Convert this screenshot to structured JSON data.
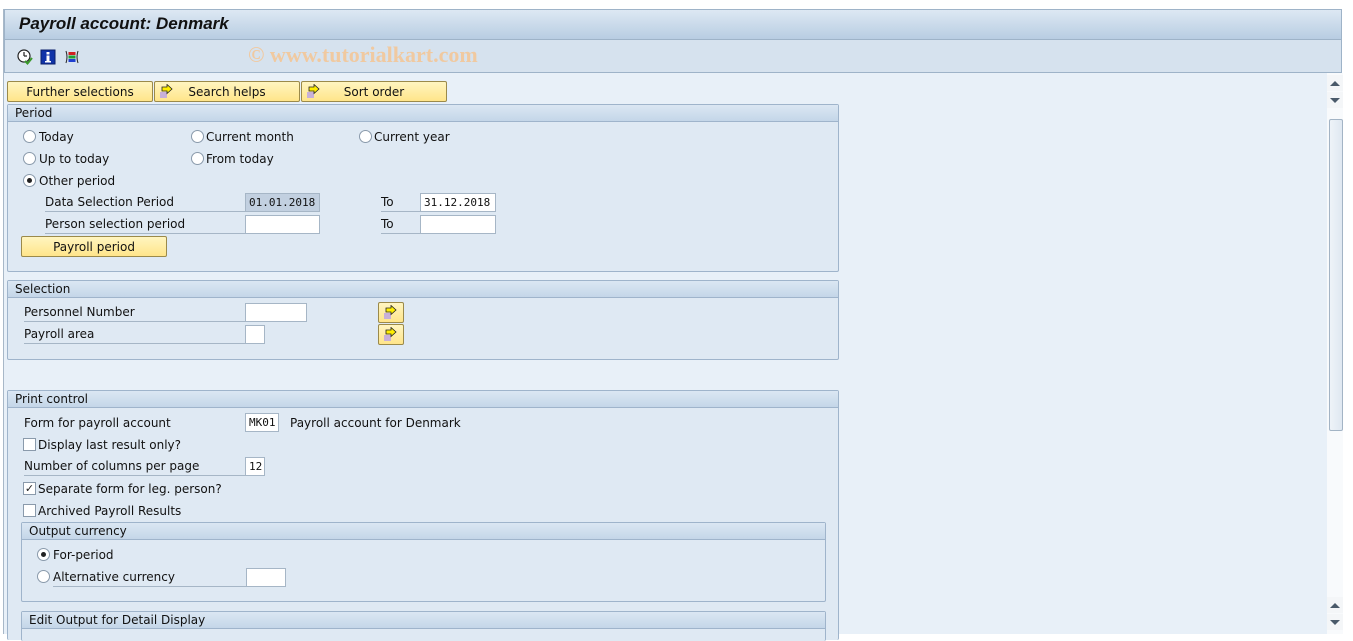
{
  "window": {
    "title": "Payroll account: Denmark",
    "watermark": "© www.tutorialkart.com"
  },
  "toolbar": {
    "icons": [
      "execute-clock-icon",
      "info-icon",
      "selection-variant-icon"
    ]
  },
  "buttons": {
    "further_selections": "Further selections",
    "search_helps": "Search helps",
    "sort_order": "Sort order"
  },
  "period": {
    "title": "Period",
    "options": {
      "today": "Today",
      "current_month": "Current month",
      "current_year": "Current year",
      "up_to_today": "Up to today",
      "from_today": "From today",
      "other_period": "Other period"
    },
    "selected": "other_period",
    "data_selection_label": "Data Selection Period",
    "data_selection_from": "01.01.2018",
    "to_label": "To",
    "data_selection_to": "31.12.2018",
    "person_selection_label": "Person selection period",
    "person_selection_from": "",
    "person_selection_to": "",
    "payroll_period_button": "Payroll period"
  },
  "selection": {
    "title": "Selection",
    "personnel_number_label": "Personnel Number",
    "personnel_number_value": "",
    "payroll_area_label": "Payroll area",
    "payroll_area_value": ""
  },
  "print_control": {
    "title": "Print control",
    "form_label": "Form for payroll account",
    "form_value": "MK01",
    "form_description": "Payroll account for Denmark",
    "display_last_label": "Display last result only?",
    "display_last_checked": false,
    "columns_label": "Number of columns per page",
    "columns_value": "12",
    "separate_form_label": "Separate form for leg. person?",
    "separate_form_checked": true,
    "archived_label": "Archived Payroll Results",
    "archived_checked": false,
    "output_currency": {
      "title": "Output currency",
      "for_period_label": "For-period",
      "alternative_label": "Alternative currency",
      "selected": "for_period",
      "alternative_value": ""
    },
    "edit_output_title": "Edit Output for Detail Display"
  }
}
